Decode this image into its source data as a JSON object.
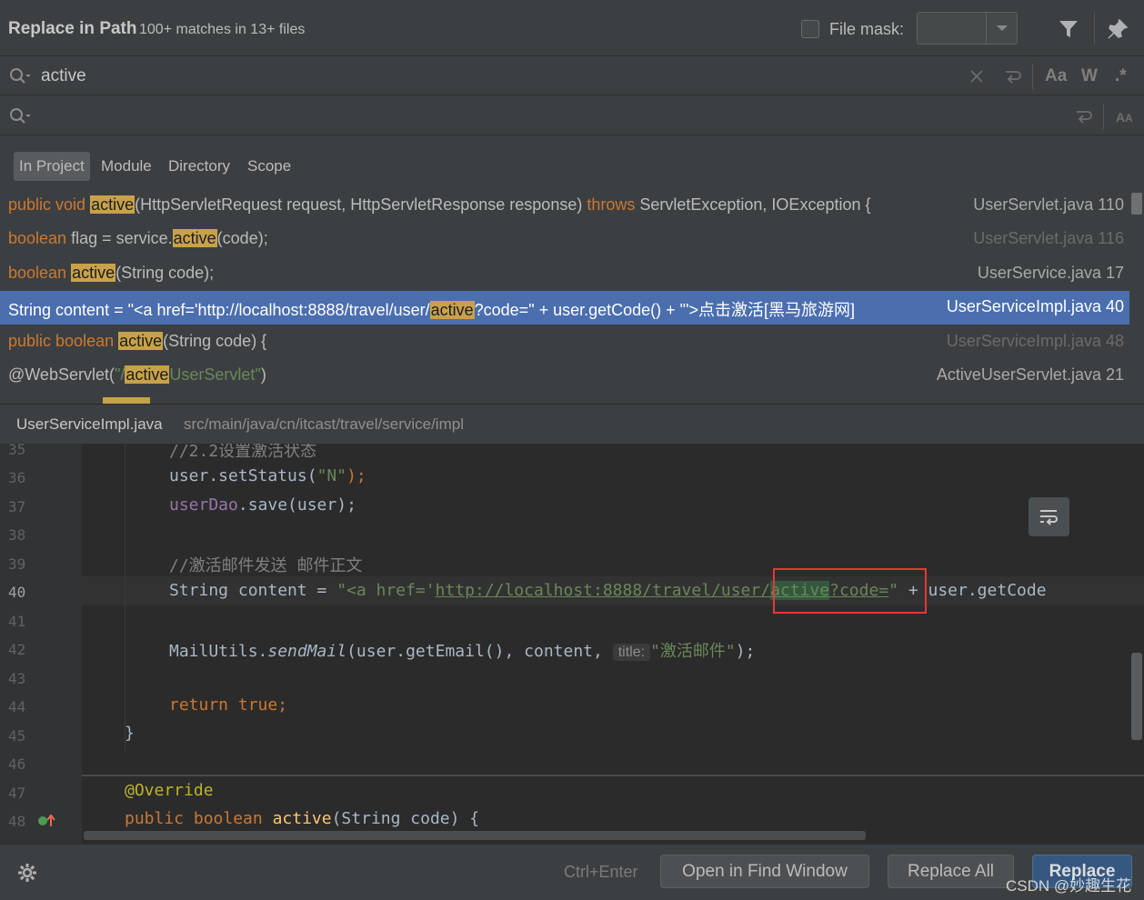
{
  "header": {
    "title": "Replace in Path",
    "subtitle": "100+ matches in 13+ files",
    "file_mask_label": "File mask:",
    "icons": [
      "filter-icon",
      "pin-icon"
    ]
  },
  "find": {
    "value": "active",
    "match_case_label": "Aa",
    "words_label": "W",
    "regex_label": ".*"
  },
  "replace": {
    "value": ""
  },
  "scope": {
    "tabs": [
      "In Project",
      "Module",
      "Directory",
      "Scope"
    ],
    "selected": "In Project"
  },
  "results": [
    {
      "pre_kw": "public void ",
      "match": "active",
      "rest": "(HttpServletRequest request, HttpServletResponse response) ",
      "kw2": "throws",
      "tail": " ServletException, IOException {",
      "file": "UserServlet.java 110"
    },
    {
      "pre_kw": "boolean",
      "plain": " flag = service.",
      "match": "active",
      "tail": "(code);",
      "file": "UserServlet.java 116"
    },
    {
      "pre_kw": "boolean ",
      "match": "active",
      "tail": "(String code);",
      "file": "UserService.java 17"
    },
    {
      "pre": "String content = \"<a href='http://localhost:8888/travel/user/",
      "match": "active",
      "tail": "?code=\" + user.getCode() + \"'>点击激活[黑马旅游网]",
      "file": "UserServiceImpl.java 40"
    },
    {
      "pre_kw": "public boolean ",
      "match": "active",
      "tail": "(String code) {",
      "file": "UserServiceImpl.java 48"
    },
    {
      "pre": "@WebServlet(",
      "str_pre": "\"/",
      "match": "active",
      "str_tail": "UserServlet\"",
      "tail": ")",
      "file": "ActiveUserServlet.java 21"
    }
  ],
  "preview": {
    "file": "UserServiceImpl.java",
    "path": "src/main/java/cn/itcast/travel/service/impl",
    "line_numbers": [
      "35",
      "36",
      "37",
      "38",
      "39",
      "40",
      "41",
      "42",
      "43",
      "44",
      "45",
      "46",
      "47",
      "48"
    ],
    "lines": {
      "l35": "//2.2设置激活状态",
      "l36a": "user.setStatus(",
      "l36b": "\"N\"",
      "l36c": ");",
      "l37a": "userDao",
      "l37b": ".save(user);",
      "l39": "//激活邮件发送 邮件正文",
      "l40a": "String content = ",
      "l40b": "\"<a href='",
      "l40c": "http://localhost:8888/travel/user/",
      "l40d": "active",
      "l40e": "?code=",
      "l40f": "\"",
      "l40g": " + user.getCode",
      "l42a": "MailUtils.",
      "l42b": "sendMail",
      "l42c": "(user.getEmail(), content, ",
      "l42hint": "title:",
      "l42d": "\"激活邮件\"",
      "l42e": ");",
      "l44": "return true;",
      "l45": "}",
      "l47": "@Override",
      "l48a": "public boolean ",
      "l48b": "active",
      "l48c": "(String code) {"
    }
  },
  "footer": {
    "shortcut": "Ctrl+Enter",
    "open_in_find_window": "Open in Find Window",
    "replace_all": "Replace All",
    "replace": "Replace",
    "watermark": "CSDN @妙趣生花"
  }
}
